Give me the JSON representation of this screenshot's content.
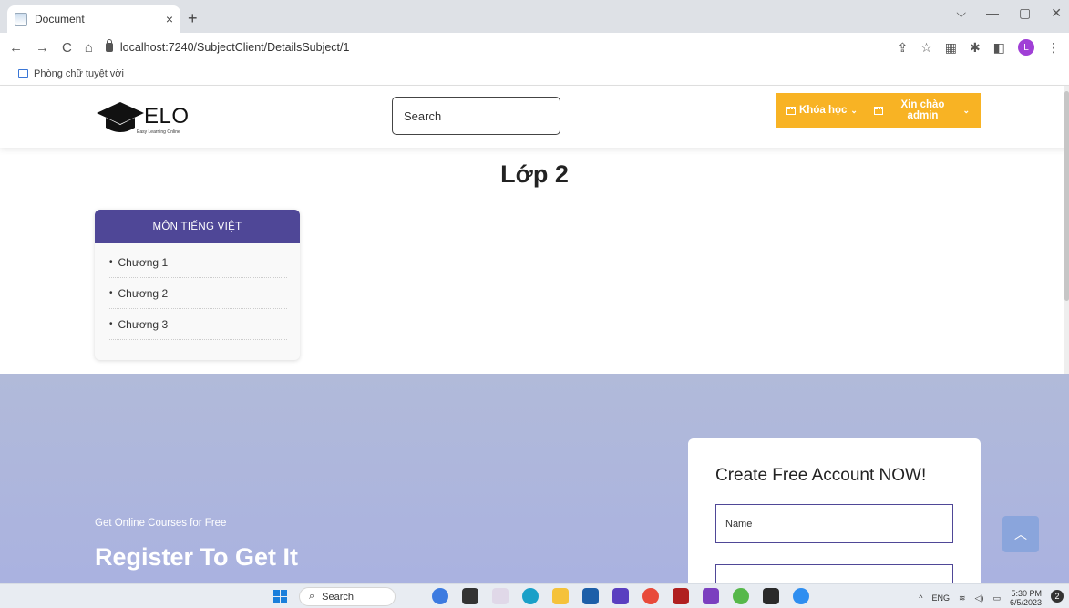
{
  "browser": {
    "tab_title": "Document",
    "tab_close": "×",
    "new_tab": "+",
    "url": "localhost:7240/SubjectClient/DetailsSubject/1",
    "bookmark_label": "Phòng chữ tuyệt vời",
    "nav": {
      "back": "←",
      "forward": "→",
      "reload": "C",
      "home": "⌂"
    },
    "window": {
      "dropdown": "⌵",
      "minimize": "—",
      "maximize": "▢",
      "close": "✕"
    },
    "avatar_letter": "L"
  },
  "header": {
    "logo_text": "ELO",
    "logo_sub": "Easy Learning Online",
    "search_placeholder": "Search",
    "menu_courses": "Khóa học",
    "menu_user": "Xin chào admin"
  },
  "main": {
    "title": "Lớp 2",
    "subject": {
      "name": "MÔN TIẾNG VIỆT",
      "chapters": [
        "Chương 1",
        "Chương 2",
        "Chương 3"
      ]
    }
  },
  "register": {
    "small_text": "Get Online Courses for Free",
    "big_text": "Register To Get It",
    "form_title": "Create Free Account NOW!",
    "name_placeholder": "Name",
    "email_placeholder": ""
  },
  "taskbar": {
    "search_label": "Search",
    "language": "ENG",
    "time": "5:30 PM",
    "date": "6/5/2023",
    "notifications": "2"
  },
  "colors": {
    "accent_orange": "#f8b324",
    "subject_header": "#4f4797",
    "register_bg": "#aab2e0"
  }
}
